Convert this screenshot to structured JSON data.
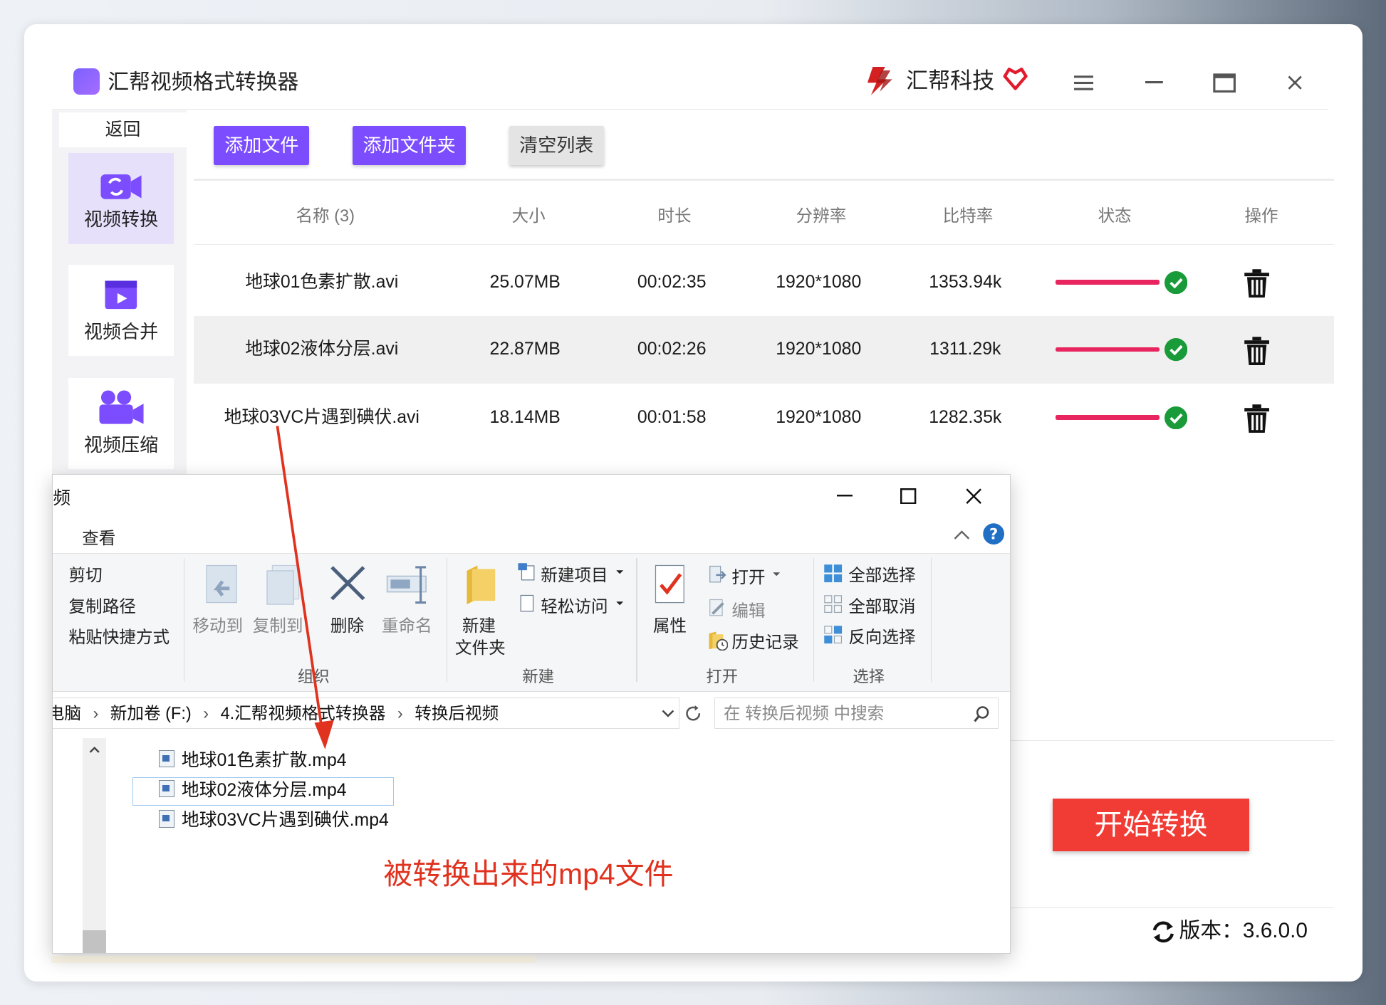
{
  "app": {
    "title": "汇帮视频格式转换器",
    "brand": "汇帮科技",
    "version_label": "版本：3.6.0.0"
  },
  "sidebar": {
    "back": "返回",
    "items": [
      {
        "label": "视频转换",
        "icon": "video-convert-icon",
        "active": true
      },
      {
        "label": "视频合并",
        "icon": "video-merge-icon",
        "active": false
      },
      {
        "label": "视频压缩",
        "icon": "video-compress-icon",
        "active": false
      }
    ]
  },
  "toolbar": {
    "add_file": "添加文件",
    "add_folder": "添加文件夹",
    "clear_list": "清空列表"
  },
  "table": {
    "headers": [
      "名称 (3)",
      "大小",
      "时长",
      "分辨率",
      "比特率",
      "状态",
      "操作"
    ],
    "rows": [
      {
        "name": "地球01色素扩散.avi",
        "size": "25.07MB",
        "duration": "00:02:35",
        "resolution": "1920*1080",
        "bitrate": "1353.94k",
        "progress": 1.0
      },
      {
        "name": "地球02液体分层.avi",
        "size": "22.87MB",
        "duration": "00:02:26",
        "resolution": "1920*1080",
        "bitrate": "1311.29k",
        "progress": 1.0
      },
      {
        "name": "地球03VC片遇到碘伏.avi",
        "size": "18.14MB",
        "duration": "00:01:58",
        "resolution": "1920*1080",
        "bitrate": "1282.35k",
        "progress": 1.0
      }
    ]
  },
  "start_button": "开始转换",
  "explorer": {
    "title": "频",
    "tab": "查看",
    "ribbon": {
      "cut": "剪切",
      "copy_path": "复制路径",
      "paste_shortcut": "粘贴快捷方式",
      "move_to": "移动到",
      "copy_to": "复制到",
      "delete": "删除",
      "rename": "重命名",
      "group_organize": "组织",
      "new_folder_line1": "新建",
      "new_folder_line2": "文件夹",
      "new_item": "新建项目",
      "easy_access": "轻松访问",
      "group_new": "新建",
      "properties": "属性",
      "open": "打开",
      "edit": "编辑",
      "history": "历史记录",
      "group_open": "打开",
      "select_all": "全部选择",
      "select_none": "全部取消",
      "invert_selection": "反向选择",
      "group_select": "选择"
    },
    "breadcrumb": [
      "电脑",
      "新加卷 (F:)",
      "4.汇帮视频格式转换器",
      "转换后视频"
    ],
    "search_placeholder": "在 转换后视频 中搜索",
    "files": [
      "地球01色素扩散.mp4",
      "地球02液体分层.mp4",
      "地球03VC片遇到碘伏.mp4"
    ],
    "annotation": "被转换出来的mp4文件"
  },
  "colors": {
    "accent_purple": "#7c4dff",
    "start_red": "#f13c35",
    "progress_pink": "#e8255e",
    "status_green": "#1a9b3a",
    "annotation_red": "#e0321e"
  }
}
